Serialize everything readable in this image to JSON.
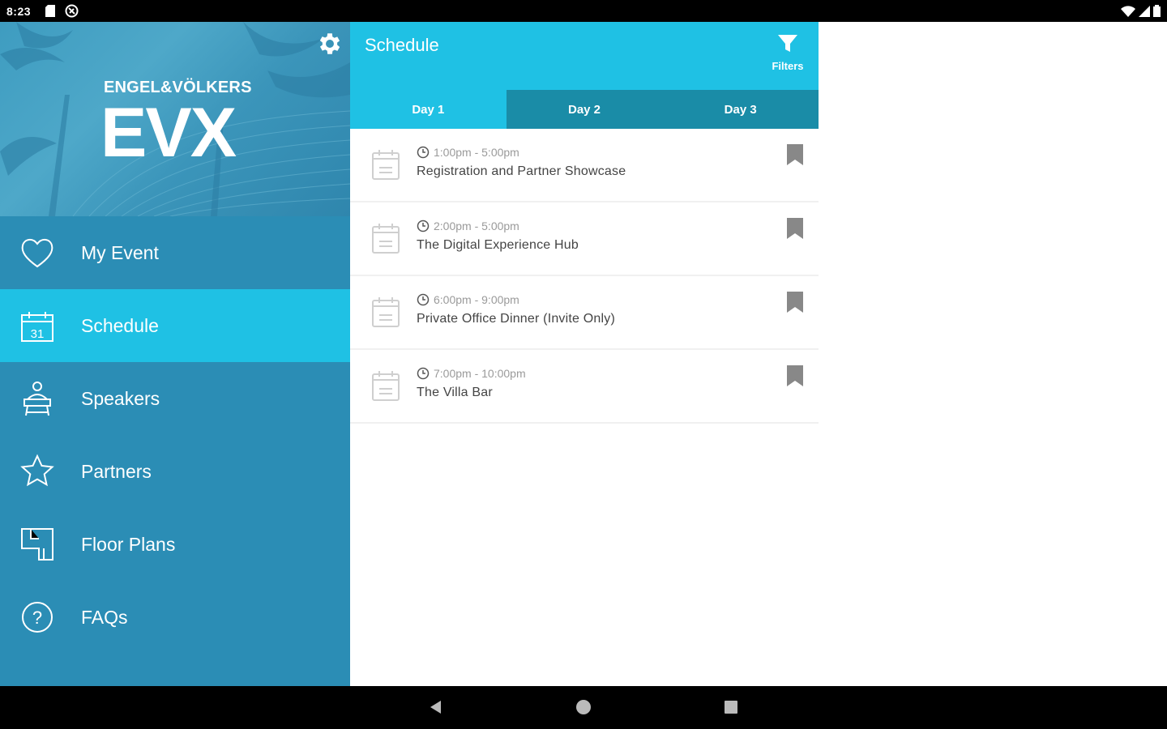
{
  "status_bar": {
    "time": "8:23"
  },
  "drawer": {
    "brand": {
      "top": "ENGEL&VÖLKERS",
      "main": "EVX"
    },
    "items": [
      {
        "label": "My Event",
        "icon": "heart-icon",
        "active": false
      },
      {
        "label": "Schedule",
        "icon": "calendar-icon",
        "active": true
      },
      {
        "label": "Speakers",
        "icon": "speaker-icon",
        "active": false
      },
      {
        "label": "Partners",
        "icon": "star-icon",
        "active": false
      },
      {
        "label": "Floor Plans",
        "icon": "floor-plan-icon",
        "active": false
      },
      {
        "label": "FAQs",
        "icon": "question-icon",
        "active": false
      }
    ]
  },
  "appbar": {
    "title": "Schedule",
    "filter_label": "Filters"
  },
  "tabs": [
    {
      "label": "Day 1",
      "active": true
    },
    {
      "label": "Day 2",
      "active": false
    },
    {
      "label": "Day 3",
      "active": false
    }
  ],
  "sessions": [
    {
      "time": "1:00pm - 5:00pm",
      "title": "Registration and Partner Showcase"
    },
    {
      "time": "2:00pm - 5:00pm",
      "title": "The Digital Experience Hub"
    },
    {
      "time": "6:00pm - 9:00pm",
      "title": "Private Office Dinner (Invite Only)"
    },
    {
      "time": "7:00pm - 10:00pm",
      "title": "The Villa Bar"
    }
  ],
  "colors": {
    "accent": "#1fc1e4",
    "drawer_bg": "#2b8db5",
    "tab_inactive": "#1a8ca7"
  }
}
